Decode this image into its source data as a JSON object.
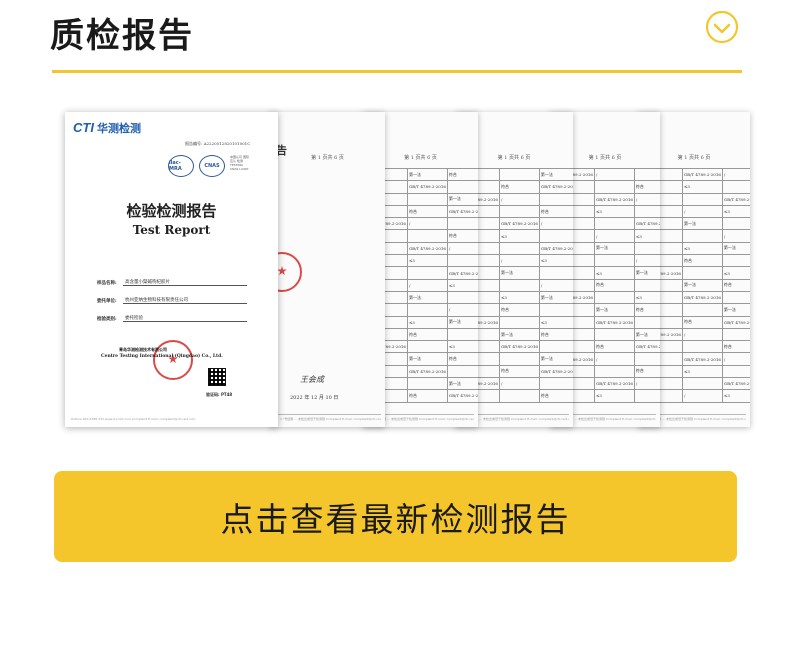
{
  "header": {
    "title": "质检报告"
  },
  "report": {
    "cover": {
      "logo_brand": "CTI",
      "logo_name": "华测检测",
      "report_no": "报告编号: A2220512820101001C",
      "cert_left": "ilac-MRA",
      "cert_right": "CNAS",
      "cert_text": "中国认可 国际互认 检测 TESTING CNAS L4497",
      "title": "检验检测报告",
      "subtitle": "Test Report",
      "fields": [
        {
          "label": "样品名称:",
          "value": "高含量小檗碱枸杞胶片"
        },
        {
          "label": "委托单位:",
          "value": "杭州亚纳生物科技有限责任公司"
        },
        {
          "label": "检验类别:",
          "value": "委托检验"
        }
      ],
      "org_cn": "青岛华测检测技术有限公司",
      "org_en": "Centre Testing International (Qingdao) Co., Ltd.",
      "verify": "验证码: PT48",
      "footer": "Hotline 400-6788-333   www.cti-cert.com   Complaint E-mail: complaint@cti-cert.com"
    },
    "inner_page_header": "第 1 页共 6 页",
    "inner_page_title": "告",
    "inner_footer": "注：1.\"号结果 ... 未检出或低于检测限 Complaint E-mail: complaint@cti-cert.com",
    "table_cells": [
      "符合",
      "GB/T 4789.2-2016",
      "/",
      "≤3",
      "第一法"
    ],
    "signature": "王会成",
    "date": "2022 年 12 月 10 日"
  },
  "cta": {
    "label": "点击查看最新检测报告"
  },
  "colors": {
    "accent": "#f5c52c",
    "rule": "#f3c72a",
    "brand_blue": "#1f5fae",
    "stamp_red": "#d72828"
  }
}
